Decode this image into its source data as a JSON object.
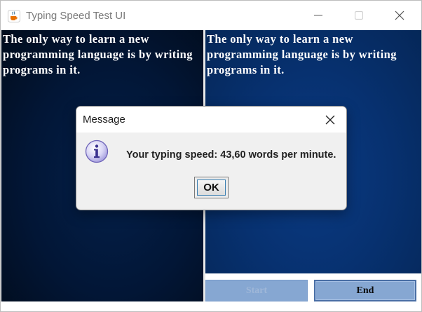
{
  "window": {
    "title": "Typing Speed Test UI",
    "icon": "java-cup-icon"
  },
  "panes": {
    "left_text": "The only way to learn a new programming language is by writing programs in it.",
    "right_text": "The only way to learn a new programming language is by writing programs in it."
  },
  "buttons": {
    "start_label": "Start",
    "end_label": "End"
  },
  "dialog": {
    "title": "Message",
    "message": "Your typing speed: 43,60 words per minute.",
    "ok_label": "OK",
    "icon": "info-icon"
  },
  "colors": {
    "left_pane_bg": "#021636",
    "right_pane_bg": "#073170",
    "button_bg": "#86a7d2"
  }
}
